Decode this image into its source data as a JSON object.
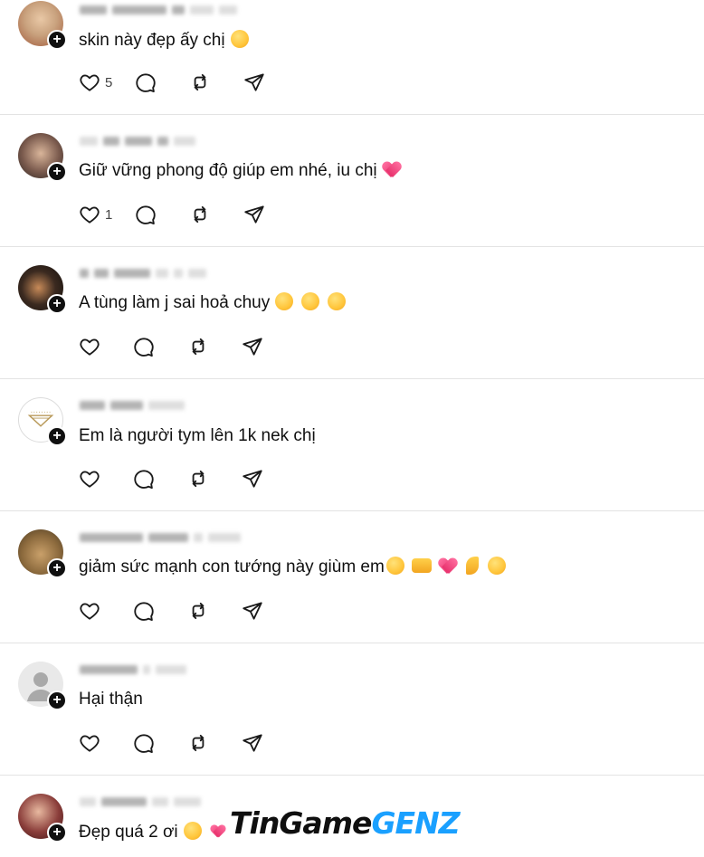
{
  "posts": [
    {
      "text": "skin này đẹp ấy chị",
      "emojis": [
        "smile"
      ],
      "likes": "5",
      "avatar_color": "#c9a27e"
    },
    {
      "text": "Giữ vững phong độ giúp em nhé, iu chị",
      "emojis": [
        "heart"
      ],
      "likes": "1",
      "avatar_color": "#5b4a44"
    },
    {
      "text": "A tùng làm j sai hoả chuy",
      "emojis": [
        "flushed",
        "flushed",
        "flushed"
      ],
      "likes": "",
      "avatar_color": "#2a211d"
    },
    {
      "text": "Em là người tym lên 1k nek chị",
      "emojis": [],
      "likes": "",
      "avatar_color": "#ffffff"
    },
    {
      "text": "giảm sức mạnh con tướng này giùm em",
      "emojis": [
        "weary",
        "hands",
        "heart",
        "finger",
        "flushed"
      ],
      "likes": "",
      "avatar_color": "#8c6a3d"
    },
    {
      "text": "Hại thận",
      "emojis": [],
      "likes": "",
      "avatar_color": "#e6e6e6"
    },
    {
      "text": "Đẹp quá 2 ơi",
      "emojis": [
        "heart-eyes",
        "hearts"
      ],
      "likes": "",
      "avatar_color": "#6b2b2b"
    }
  ],
  "watermark": {
    "part1": "TinGame",
    "part2": "GENZ"
  },
  "icons": {
    "like": "heart-outline-icon",
    "comment": "comment-bubble-icon",
    "repost": "repost-icon",
    "share": "send-icon",
    "follow": "plus-icon"
  },
  "colors": {
    "text": "#101010",
    "divider": "#e3e3e3",
    "watermark_accent": "#1aa0ff"
  }
}
